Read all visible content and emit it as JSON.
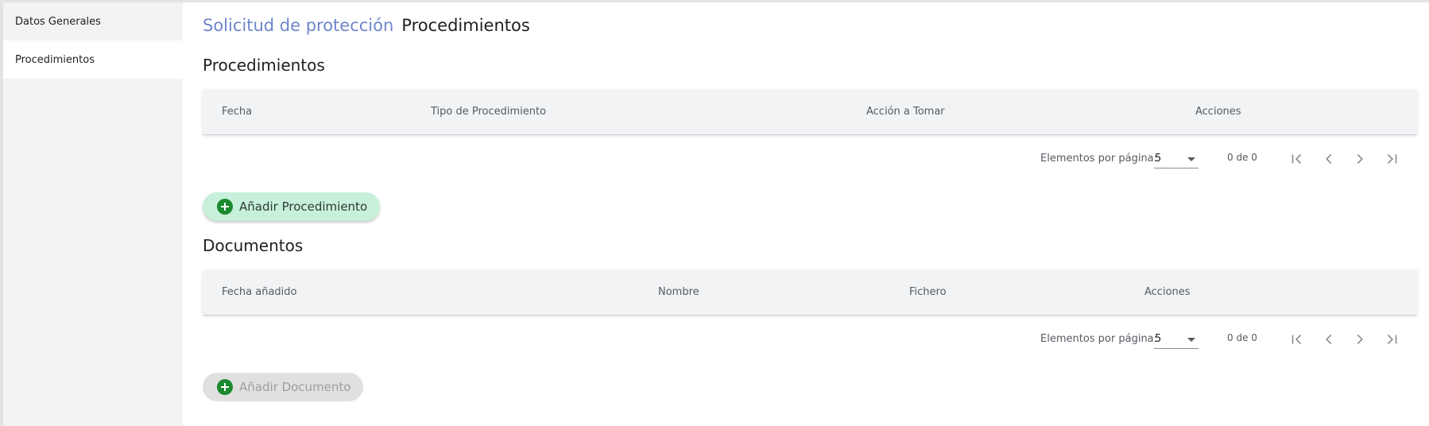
{
  "sidebar": {
    "items": [
      {
        "label": "Datos Generales",
        "active": false
      },
      {
        "label": "Procedimientos",
        "active": true
      }
    ]
  },
  "breadcrumb": {
    "parent": "Solicitud de protección",
    "current": "Procedimientos"
  },
  "procedimientos": {
    "title": "Procedimientos",
    "columns": [
      "Fecha",
      "Tipo de Procedimiento",
      "Acción a Tomar",
      "Acciones"
    ],
    "rows": [],
    "paginator": {
      "items_per_page_label": "Elementos por página:",
      "page_size": "5",
      "range_label": "0 de 0"
    },
    "add_button_label": "Añadir Procedimiento"
  },
  "documentos": {
    "title": "Documentos",
    "columns": [
      "Fecha añadido",
      "Nombre",
      "Fichero",
      "Acciones"
    ],
    "rows": [],
    "paginator": {
      "items_per_page_label": "Elementos por página:",
      "page_size": "5",
      "range_label": "0 de 0"
    },
    "add_button_label": "Añadir Documento",
    "add_button_disabled": true
  },
  "colors": {
    "link": "#6f86cc",
    "sidebar_bg": "#f1f3f5",
    "table_header_bg": "#f1f3f5",
    "primary_button_bg": "#c7f0da",
    "add_icon": "#1b8a2f",
    "disabled_button_bg": "#e0e0e0"
  }
}
